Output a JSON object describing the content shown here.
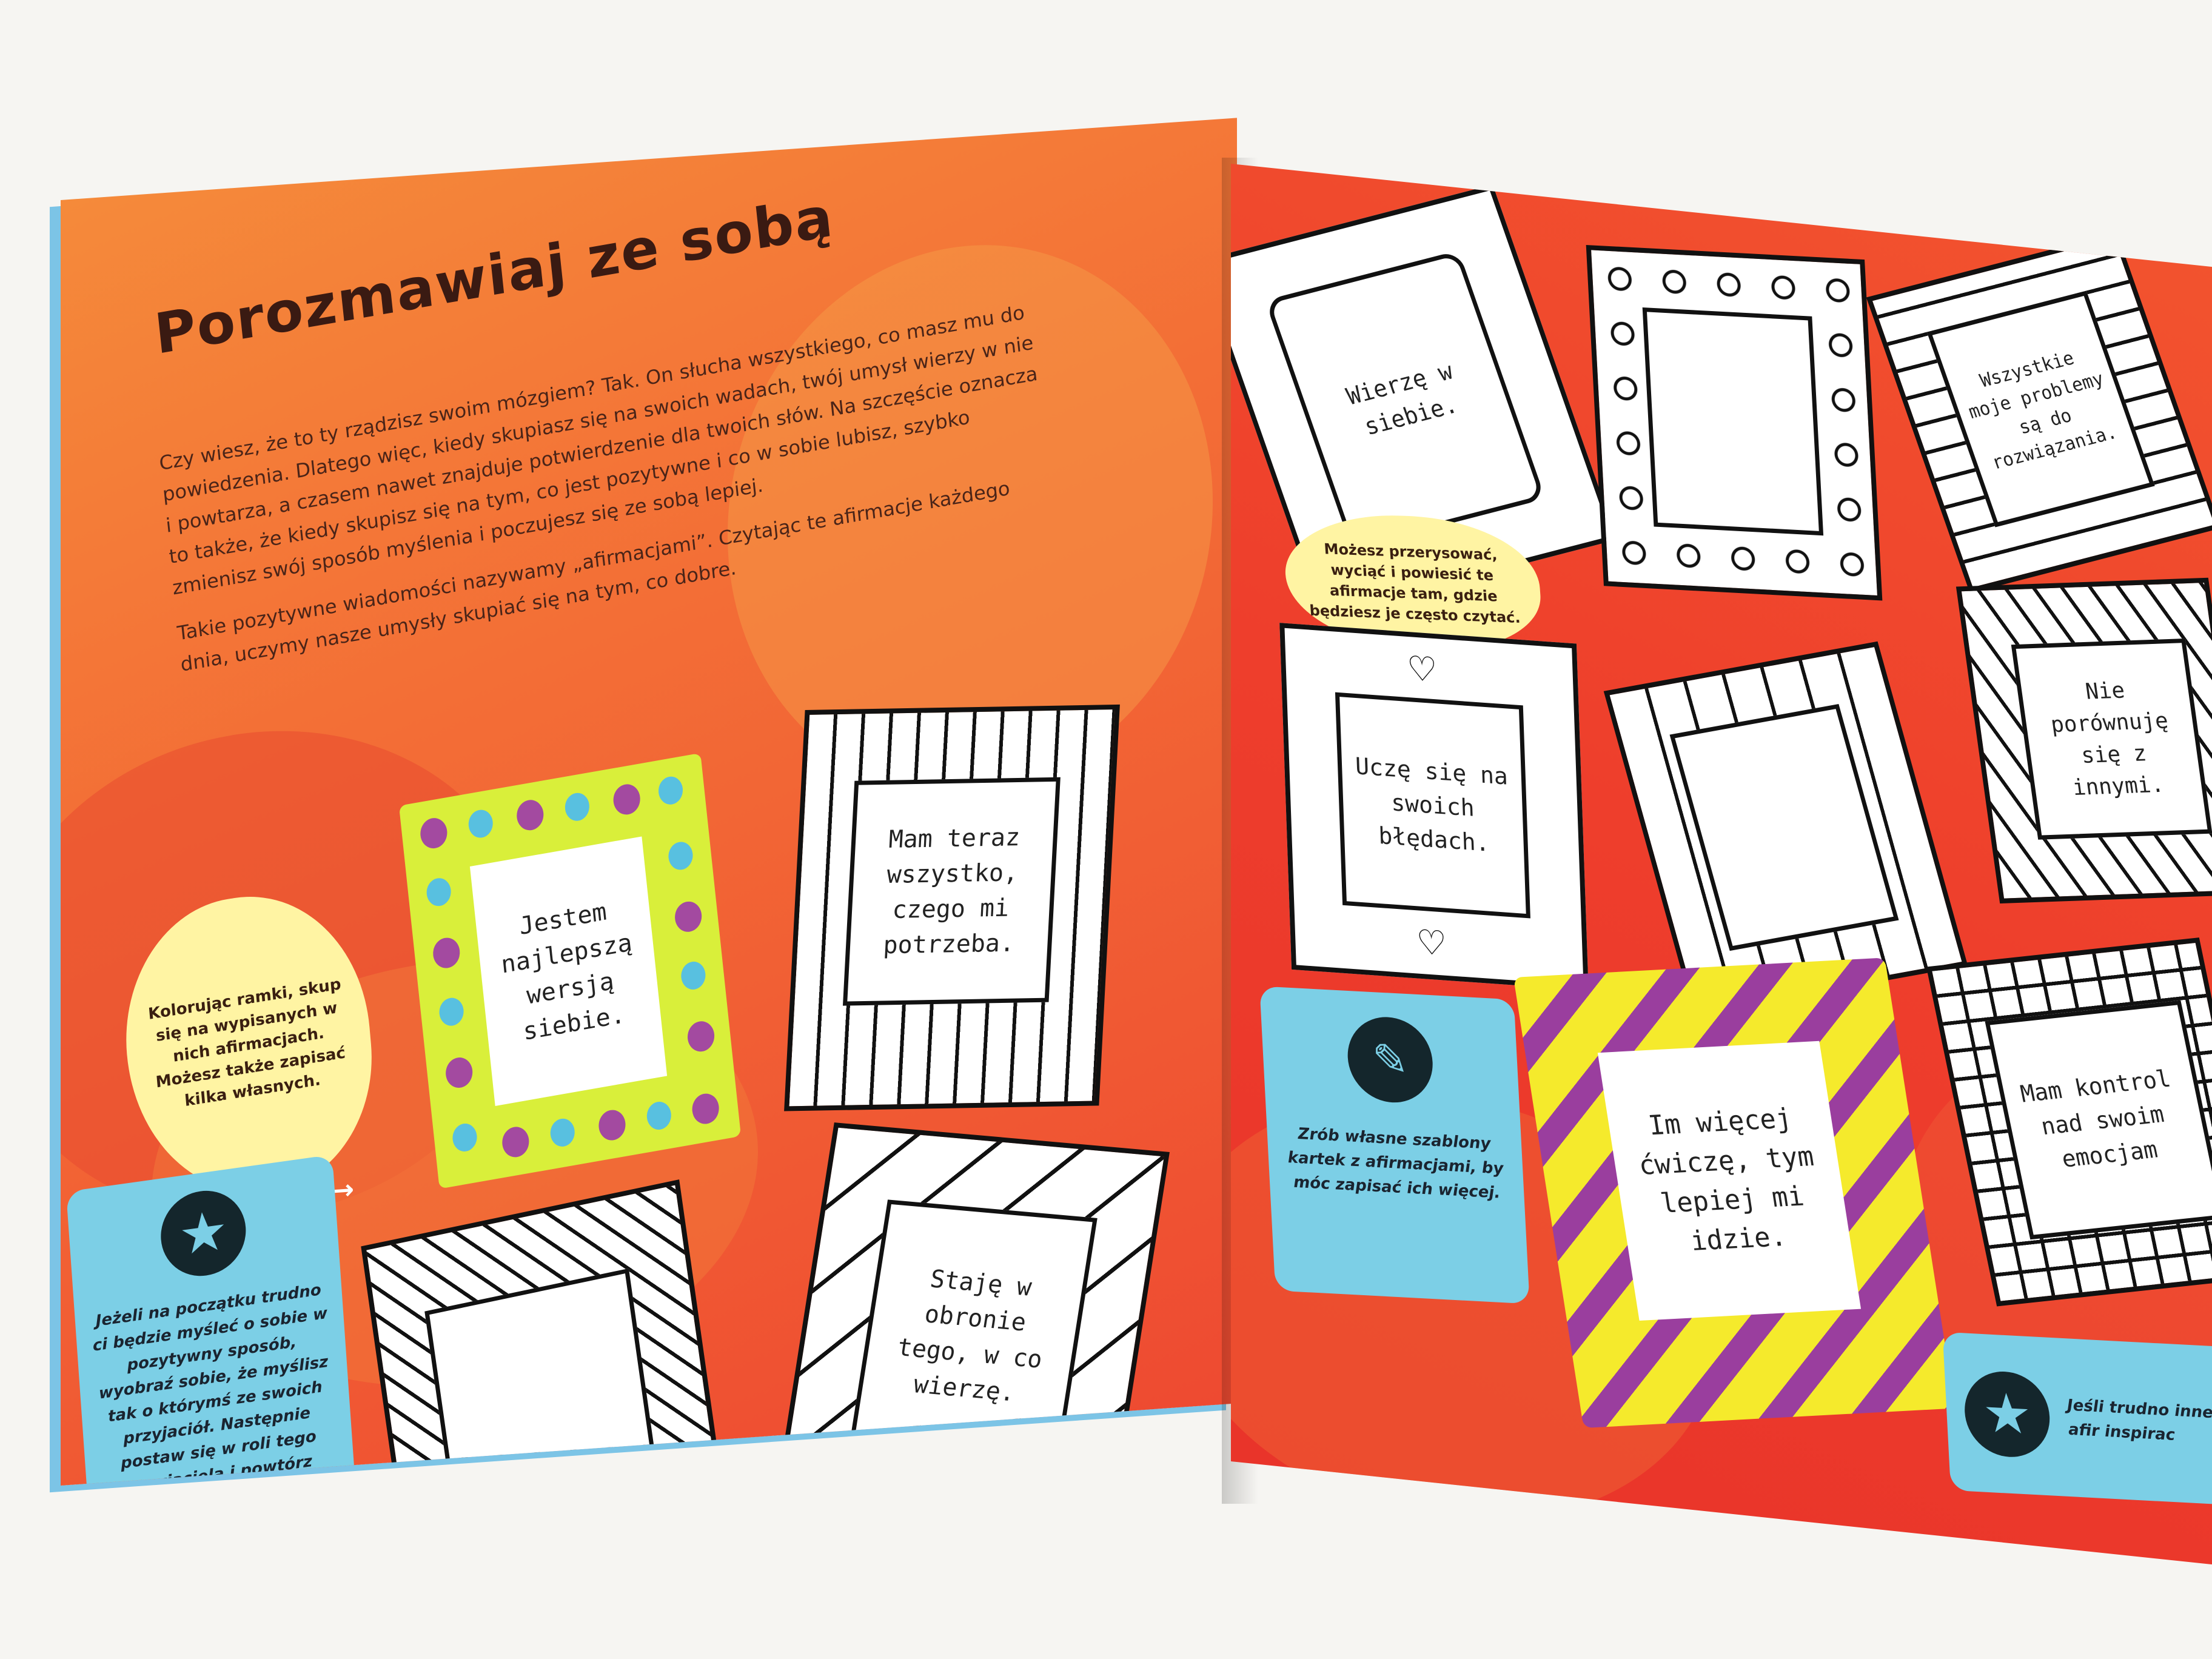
{
  "left_page": {
    "title": "Porozmawiaj ze sobą",
    "intro_paragraphs": [
      "Czy wiesz, że to ty rządzisz swoim mózgiem? Tak. On słucha wszystkiego, co masz mu do powiedzenia. Dlatego więc, kiedy skupiasz się na swoich wadach, twój umysł wierzy w nie i powtarza, a czasem nawet znajduje potwierdzenie dla twoich słów. Na szczęście oznacza to także, że kiedy skupisz się na tym, co jest pozytywne i co w sobie lubisz, szybko zmienisz swój sposób myślenia i poczujesz się ze sobą lepiej.",
      "Takie pozytywne wiadomości nazywamy „afirmacjami”. Czytając te afirmacje każdego dnia, uczymy nasze umysły skupiać się na tym, co dobre."
    ],
    "cloud_tip": "Kolorując ramki, skup się na wypisanych w nich afirmacjach. Możesz także zapisać kilka własnych.",
    "star_tip": "Jeżeli na początku trudno ci będzie myśleć o sobie w pozytywny sposób, wyobraź sobie, że myślisz tak o którymś ze swoich przyjaciół. Następnie postaw się w roli tego przyjaciela i powtórz sobie te same afirmacje!",
    "frames": [
      {
        "text": "Jestem najlepszą wersją siebie."
      },
      {
        "text": "Mam teraz wszystko, czego mi potrzeba."
      },
      {
        "text": ""
      },
      {
        "text": "Staję w obronie tego, w co wierzę."
      }
    ]
  },
  "right_page": {
    "cloud_tip": "Możesz przerysować, wyciąć i powiesić te afirmacje tam, gdzie będziesz je często czytać.",
    "pencil_tip": "Zrób własne szablony kartek z afirmacjami, by móc zapisać ich więcej.",
    "star_tip_partial": "Jeśli trudno inne afir inspirac",
    "frames": [
      {
        "text": "Wierzę w siebie."
      },
      {
        "text": ""
      },
      {
        "text": "Wszystkie moje problemy są do rozwiązania."
      },
      {
        "text": "Uczę się na swoich błędach."
      },
      {
        "text": ""
      },
      {
        "text": "Nie porównuję się z innymi."
      },
      {
        "text": "Im więcej ćwiczę, tym lepiej mi idzie."
      },
      {
        "text": "Mam kontrol nad swoim emocjam"
      }
    ]
  },
  "colors": {
    "left_page_orange": "#f36d36",
    "right_page_red": "#ee3e2c",
    "cloud_yellow": "#fff4a3",
    "tip_blue": "#7ccfe6",
    "frame_lime": "#d9ef3a",
    "dot_purple": "#a34aa0",
    "dot_blue": "#58c0e0",
    "stripe_yellow": "#f5ea2c",
    "stripe_purple": "#9a3e9e"
  }
}
